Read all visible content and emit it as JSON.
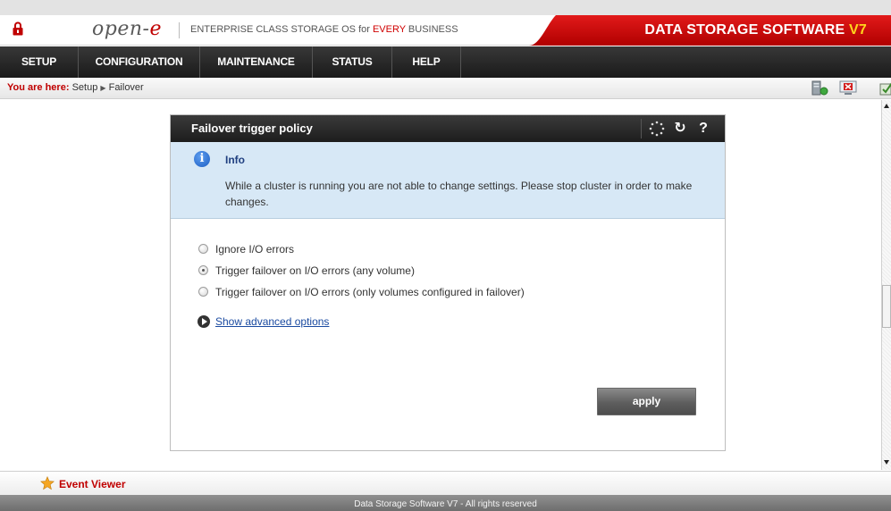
{
  "header": {
    "logo_text": "open-",
    "logo_e": "e",
    "tagline_prefix": "ENTERPRISE CLASS STORAGE OS for ",
    "tagline_every": "EVERY",
    "tagline_suffix": " BUSINESS",
    "brand": "DATA STORAGE SOFTWARE ",
    "brand_version": "V7"
  },
  "nav": {
    "items": [
      {
        "label": "SETUP"
      },
      {
        "label": "CONFIGURATION"
      },
      {
        "label": "MAINTENANCE"
      },
      {
        "label": "STATUS"
      },
      {
        "label": "HELP"
      }
    ]
  },
  "breadcrumb": {
    "label": "You are here:",
    "path_setup": "Setup",
    "path_failover": "Failover"
  },
  "panel": {
    "title": "Failover trigger policy",
    "info_title": "Info",
    "info_text": "While a cluster is running you are not able to change settings. Please stop cluster in order to make changes.",
    "options": [
      {
        "label": "Ignore I/O errors",
        "selected": false
      },
      {
        "label": "Trigger failover on I/O errors (any volume)",
        "selected": true
      },
      {
        "label": "Trigger failover on I/O errors (only volumes configured in failover)",
        "selected": false
      }
    ],
    "advanced_link": "Show advanced options",
    "apply_label": "apply"
  },
  "event_viewer": {
    "label": "Event Viewer"
  },
  "footer": {
    "text": "Data Storage Software V7 - All rights reserved"
  },
  "colors": {
    "brand_red": "#d40000",
    "accent_yellow": "#ffd51c",
    "nav_dark": "#1a1a1a",
    "info_blue": "#d7e8f6"
  }
}
